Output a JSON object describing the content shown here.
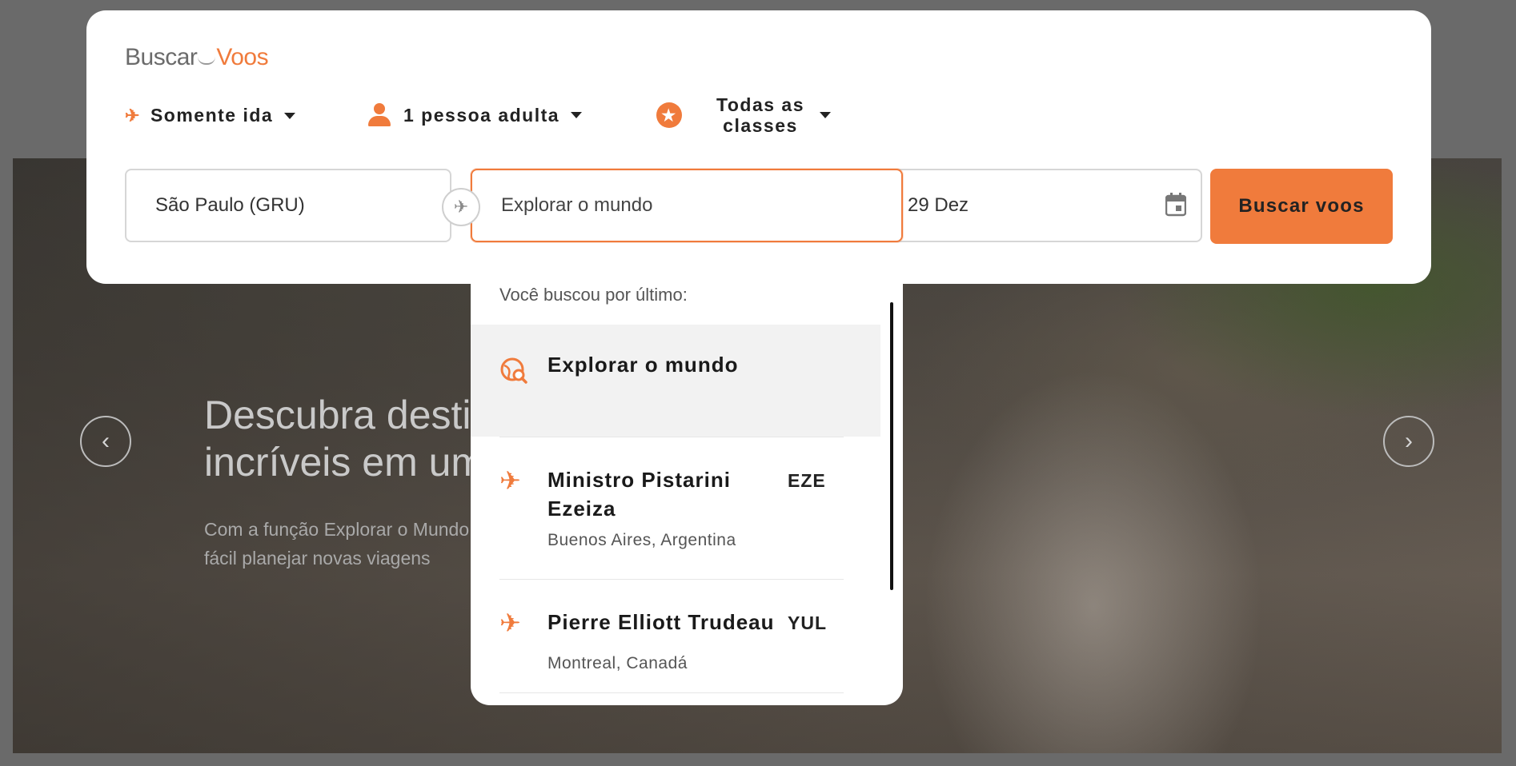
{
  "logo": {
    "part1": "Buscar",
    "part2": "Voos"
  },
  "options": {
    "trip_type": "Somente ida",
    "passengers": "1 pessoa adulta",
    "cabin_class": "Todas as classes"
  },
  "search": {
    "origin": "São Paulo (GRU)",
    "destination": "Explorar o mundo",
    "date": "29 Dez",
    "button": "Buscar voos"
  },
  "dropdown": {
    "header": "Você buscou por último:",
    "items": [
      {
        "name": "Explorar o mundo",
        "icon": "globe-search-icon"
      },
      {
        "name": "Ministro Pistarini Ezeiza",
        "code": "EZE",
        "location": "Buenos Aires, Argentina",
        "icon": "plane-icon"
      },
      {
        "name": "Pierre Elliott Trudeau",
        "code": "YUL",
        "location": "Montreal, Canadá",
        "icon": "plane-icon"
      }
    ]
  },
  "hero": {
    "title": "Descubra destinos incríveis em um clique",
    "text": "Com a função Explorar o Mundo, fica fácil planejar novas viagens"
  },
  "colors": {
    "accent": "#f07b3c",
    "highlight": "#f2f2f2"
  }
}
